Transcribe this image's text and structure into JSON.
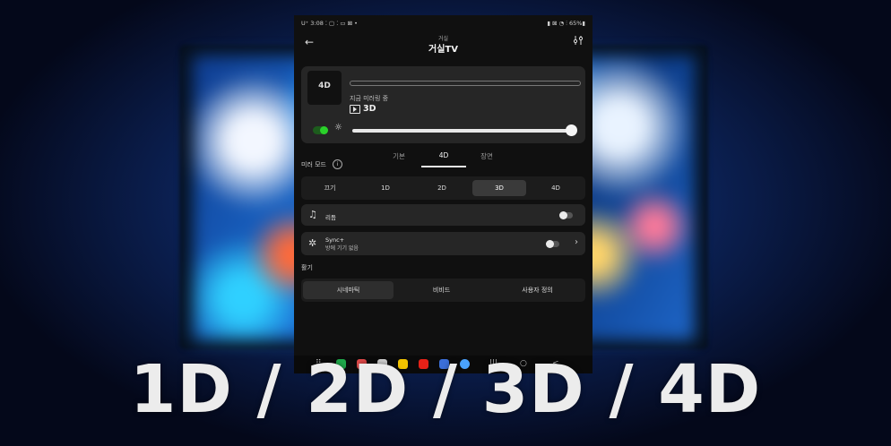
{
  "status_bar": {
    "time": "U⁺ 3:08 ⁚ ▢ ⁚ ▭ ⊠ •",
    "right": "▮ ⊠ ◔ ⫶ 65%▮"
  },
  "header": {
    "room": "거실",
    "title": "거실TV"
  },
  "now_playing": {
    "thumb_label": "4D",
    "status": "지금 미러링 중",
    "mode": "3D"
  },
  "tabs": [
    "기본",
    "4D",
    "장면"
  ],
  "mirror_mode": {
    "label": "미러 모드",
    "options": [
      "끄기",
      "1D",
      "2D",
      "3D",
      "4D"
    ],
    "selected": "3D"
  },
  "rhythm": {
    "label": "리듬"
  },
  "sync": {
    "label": "Sync+",
    "sub": "방에 기기 없음"
  },
  "vividness": {
    "label": "활기",
    "options": [
      "시네마틱",
      "비비드",
      "사용자 정의"
    ],
    "selected": "시네마틱"
  },
  "caption": "1D / 2D / 3D / 4D",
  "colors": {
    "toggle_on": "#2ad12a",
    "card": "#262626",
    "bg": "#101010"
  }
}
